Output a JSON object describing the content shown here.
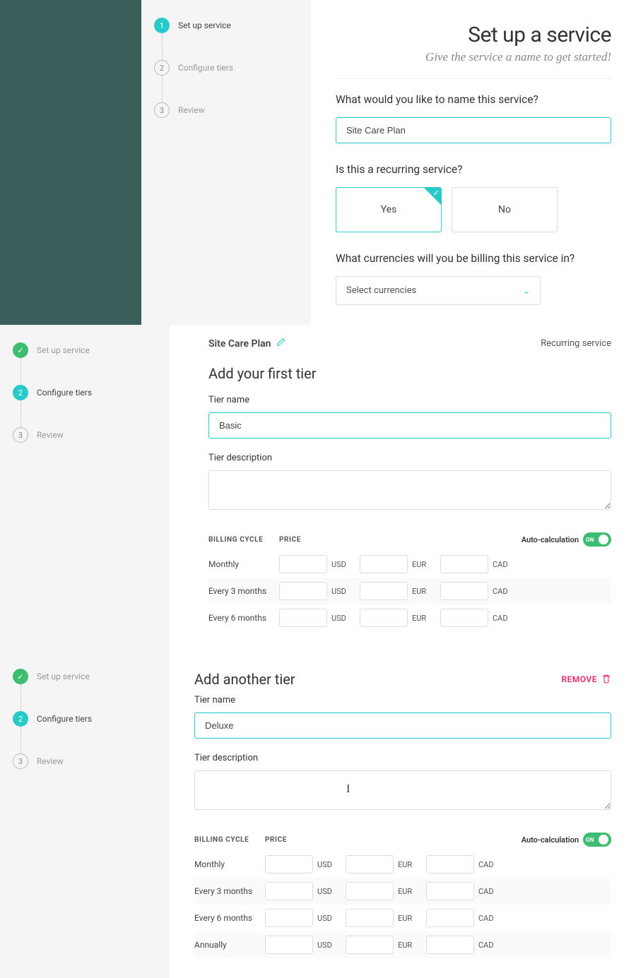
{
  "steps": {
    "s1": "Set up service",
    "s2": "Configure tiers",
    "s3": "Review",
    "n1": "1",
    "n2": "2",
    "n3": "3",
    "check": "✓"
  },
  "hero": {
    "title": "Set up a service",
    "subtitle": "Give the service a name to get started!"
  },
  "q1": {
    "label": "What would you like to name this service?",
    "value": "Site Care Plan"
  },
  "q2": {
    "label": "Is this a recurring service?",
    "yes": "Yes",
    "no": "No"
  },
  "q3": {
    "label": "What currencies will you be billing this service in?",
    "placeholder": "Select currencies"
  },
  "plan": {
    "name": "Site Care Plan",
    "type": "Recurring service"
  },
  "tier1": {
    "heading": "Add your first tier",
    "name_label": "Tier name",
    "name_value": "Basic",
    "desc_label": "Tier description"
  },
  "tier2": {
    "heading": "Add another tier",
    "remove": "REMOVE",
    "name_label": "Tier name",
    "name_value": "Deluxe",
    "desc_label": "Tier description"
  },
  "price": {
    "col_cycle": "BILLING CYCLE",
    "col_price": "PRICE",
    "autocalc": "Auto-calculation",
    "switch": "ON",
    "cycles3": [
      "Monthly",
      "Every 3 months",
      "Every 6 months"
    ],
    "cycles4": [
      "Monthly",
      "Every 3 months",
      "Every 6 months",
      "Annually"
    ],
    "currs": [
      "USD",
      "EUR",
      "CAD"
    ]
  }
}
